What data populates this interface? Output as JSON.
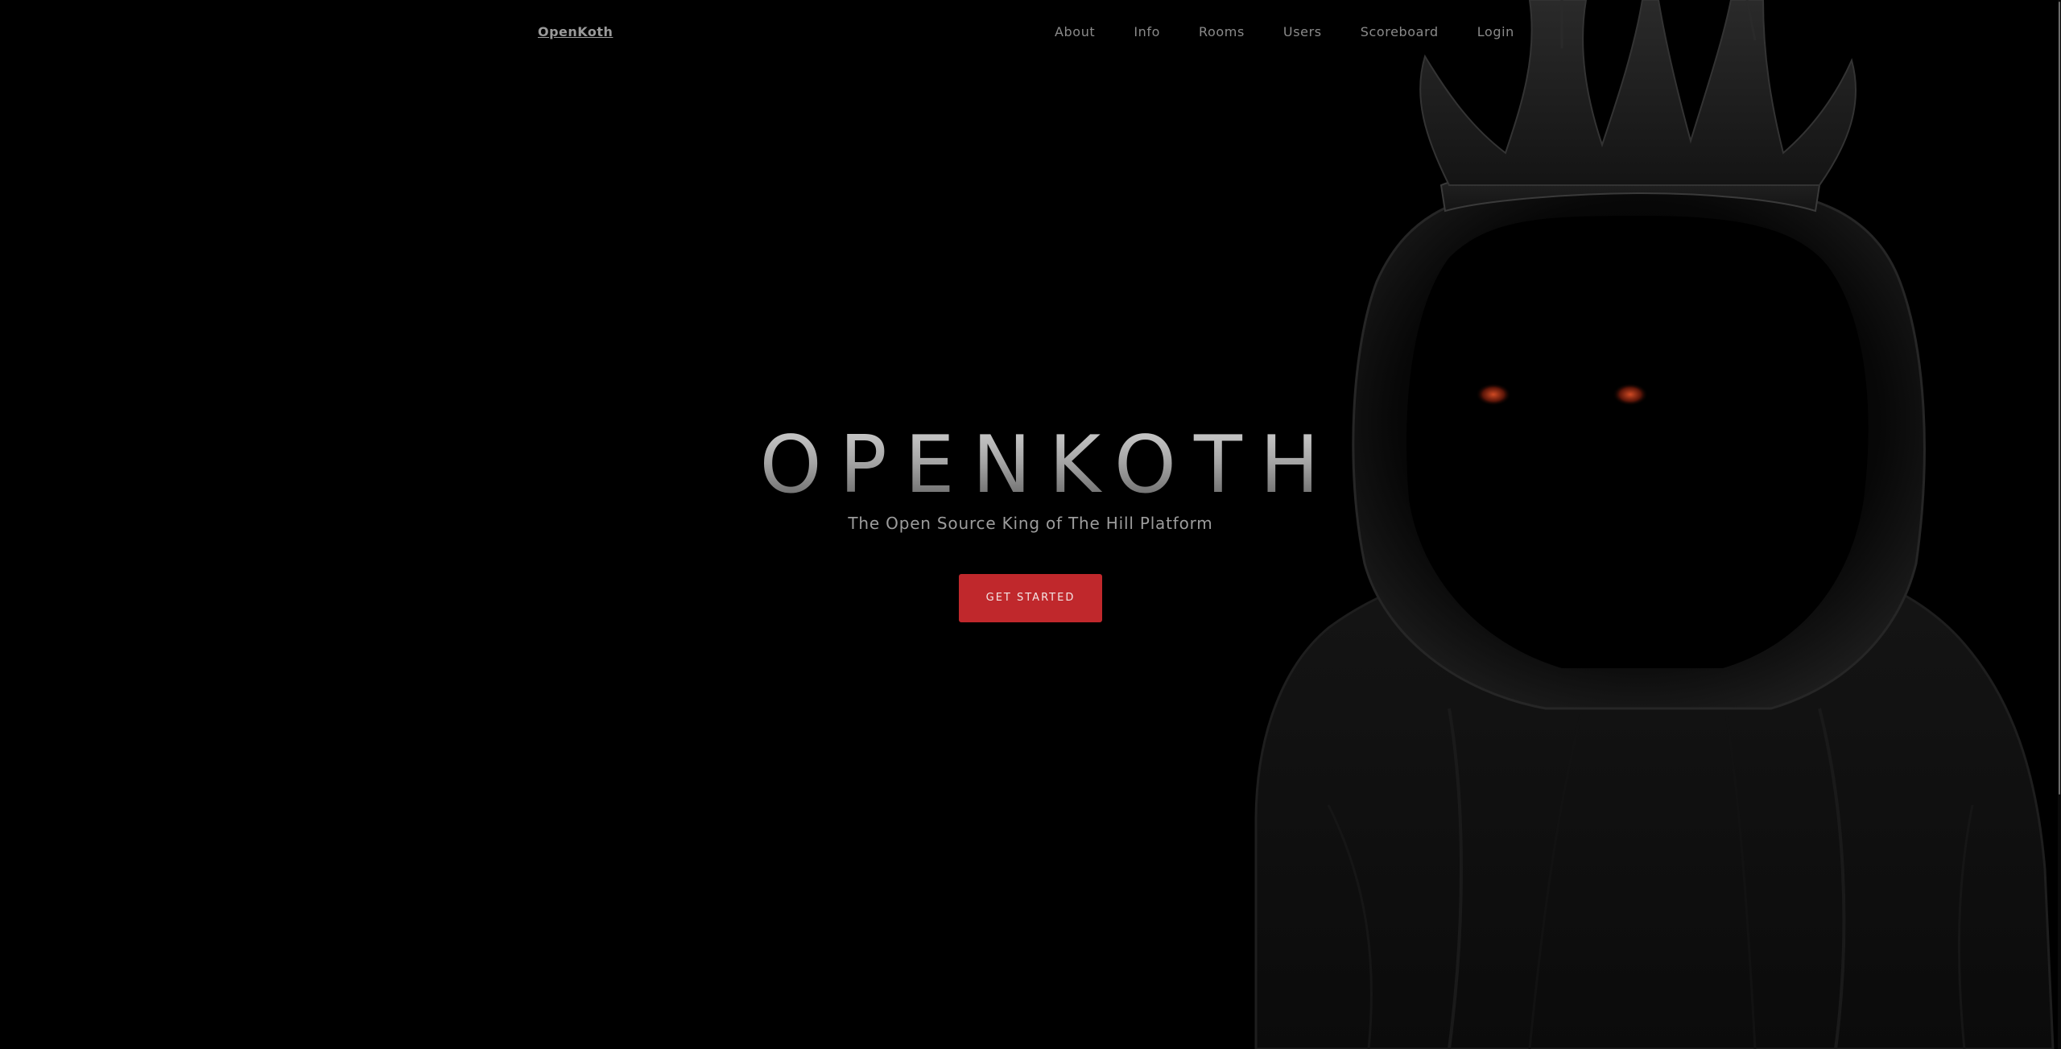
{
  "nav": {
    "brand": "OpenKoth",
    "links": [
      {
        "label": "About"
      },
      {
        "label": "Info"
      },
      {
        "label": "Rooms"
      },
      {
        "label": "Users"
      },
      {
        "label": "Scoreboard"
      },
      {
        "label": "Login"
      }
    ]
  },
  "hero": {
    "title": "OPENKOTH",
    "subtitle": "The Open Source King of The Hill Platform",
    "cta_label": "GET STARTED"
  },
  "colors": {
    "background": "#000000",
    "accent": "#c0282c",
    "nav_text": "#8a8a8a",
    "eye_glow": "#a8321c"
  },
  "icons": {
    "hero_image": "hooded-king-illustration"
  }
}
